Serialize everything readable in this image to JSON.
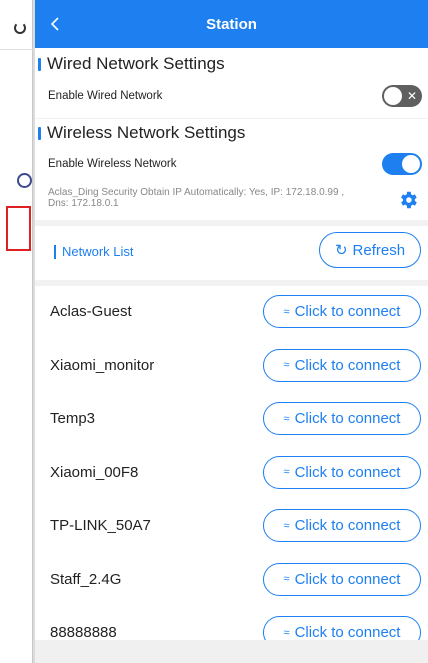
{
  "header": {
    "title": "Station",
    "back_icon": "chevron-left-icon"
  },
  "wired": {
    "section_title": "Wired Network Settings",
    "enable_label": "Enable Wired Network",
    "enabled": false
  },
  "wireless": {
    "section_title": "Wireless Network Settings",
    "enable_label": "Enable Wireless Network",
    "enabled": true,
    "status_line1": "Aclas_Ding Security Obtain IP Automatically:  Yes, IP: 172.18.0.99 ,",
    "status_line2": "Dns: 172.18.0.1",
    "settings_icon": "gear-icon"
  },
  "network_list": {
    "label": "Network List",
    "refresh_label": "Refresh",
    "networks": [
      {
        "name": "Aclas-Guest",
        "action": "Click to connect"
      },
      {
        "name": "Xiaomi_monitor",
        "action": "Click to connect"
      },
      {
        "name": "Temp3",
        "action": "Click to connect"
      },
      {
        "name": "Xiaomi_00F8",
        "action": "Click to connect"
      },
      {
        "name": "TP-LINK_50A7",
        "action": "Click to connect"
      },
      {
        "name": "Staff_2.4G",
        "action": "Click to connect"
      },
      {
        "name": "88888888",
        "action": "Click to connect"
      }
    ]
  },
  "colors": {
    "accent": "#1e7ff0",
    "toggle_off": "#5f5f5f"
  }
}
